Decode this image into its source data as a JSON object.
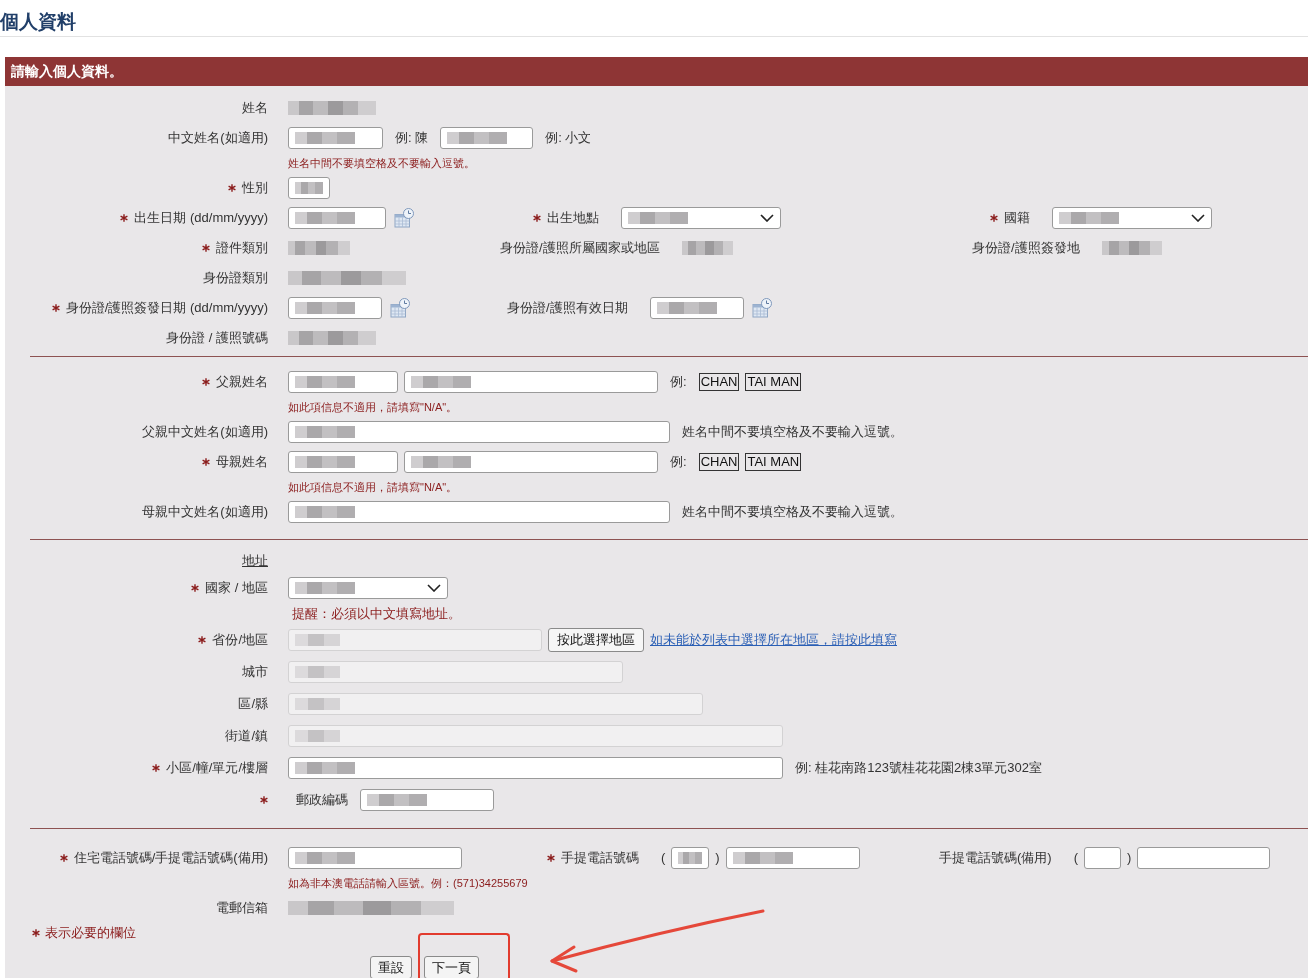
{
  "page_title": "個人資料",
  "panel": {
    "title": "請輸入個人資料。"
  },
  "sections": [
    {
      "rows": [
        {
          "kind": "fields",
          "cells": [
            {
              "label": "姓名",
              "required": false,
              "items": [
                {
                  "kind": "blurred"
                }
              ]
            }
          ]
        },
        {
          "kind": "fields",
          "cells": [
            {
              "label": "中文姓名(如適用)",
              "required": false,
              "items": [
                {
                  "kind": "input",
                  "filled": true
                },
                {
                  "kind": "hint",
                  "text": "例: 陳"
                },
                {
                  "kind": "input",
                  "filled": true
                },
                {
                  "kind": "hint",
                  "text": "例: 小文"
                }
              ]
            }
          ]
        },
        {
          "kind": "note",
          "text": "姓名中間不要填空格及不要輸入逗號。"
        },
        {
          "kind": "fields",
          "cells": [
            {
              "label": "性別",
              "required": true,
              "items": [
                {
                  "kind": "input",
                  "filled": true
                }
              ]
            }
          ]
        },
        {
          "kind": "fields",
          "cells": [
            {
              "label": "出生日期 (dd/mm/yyyy)",
              "required": true,
              "items": [
                {
                  "kind": "date",
                  "filled": true
                }
              ]
            },
            {
              "label": "出生地點",
              "required": true,
              "items": [
                {
                  "kind": "select",
                  "filled": true
                }
              ]
            },
            {
              "label": "國籍",
              "required": true,
              "items": [
                {
                  "kind": "select",
                  "filled": true
                }
              ]
            }
          ]
        },
        {
          "kind": "fields",
          "cells": [
            {
              "label": "證件類別",
              "required": true,
              "items": [
                {
                  "kind": "blurred"
                }
              ]
            },
            {
              "label": "身份證/護照所屬國家或地區",
              "required": false,
              "items": [
                {
                  "kind": "blurred"
                }
              ]
            },
            {
              "label": "身份證/護照簽發地",
              "required": false,
              "items": [
                {
                  "kind": "blurred"
                }
              ]
            }
          ]
        },
        {
          "kind": "fields",
          "cells": [
            {
              "label": "身份證類別",
              "required": false,
              "items": [
                {
                  "kind": "blurred"
                }
              ]
            }
          ]
        },
        {
          "kind": "fields",
          "cells": [
            {
              "label": "身份證/護照簽發日期 (dd/mm/yyyy)",
              "required": true,
              "items": [
                {
                  "kind": "date",
                  "filled": true
                }
              ]
            },
            {
              "label": "身份證/護照有效日期",
              "required": false,
              "items": [
                {
                  "kind": "date",
                  "filled": true
                }
              ]
            }
          ]
        },
        {
          "kind": "fields",
          "cells": [
            {
              "label": "身份證 / 護照號碼",
              "required": false,
              "items": [
                {
                  "kind": "blurred"
                }
              ]
            }
          ]
        }
      ]
    },
    {
      "rows": [
        {
          "kind": "fields",
          "cells": [
            {
              "label": "父親姓名",
              "required": true,
              "items": [
                {
                  "kind": "input",
                  "filled": true
                },
                {
                  "kind": "input",
                  "filled": true
                },
                {
                  "kind": "hint",
                  "text": "例:"
                },
                {
                  "kind": "example",
                  "text": "CHAN"
                },
                {
                  "kind": "example",
                  "text": "TAI MAN"
                }
              ]
            }
          ]
        },
        {
          "kind": "note",
          "text": "如此項信息不適用，請填寫\"N/A\"。"
        },
        {
          "kind": "fields",
          "cells": [
            {
              "label": "父親中文姓名(如適用)",
              "required": false,
              "items": [
                {
                  "kind": "input",
                  "filled": true
                },
                {
                  "kind": "hint",
                  "text": "姓名中間不要填空格及不要輸入逗號。"
                }
              ]
            }
          ]
        },
        {
          "kind": "fields",
          "cells": [
            {
              "label": "母親姓名",
              "required": true,
              "items": [
                {
                  "kind": "input",
                  "filled": true
                },
                {
                  "kind": "input",
                  "filled": true
                },
                {
                  "kind": "hint",
                  "text": "例:"
                },
                {
                  "kind": "example",
                  "text": "CHAN"
                },
                {
                  "kind": "example",
                  "text": "TAI MAN"
                }
              ]
            }
          ]
        },
        {
          "kind": "note",
          "text": "如此項信息不適用，請填寫\"N/A\"。"
        },
        {
          "kind": "fields",
          "cells": [
            {
              "label": "母親中文姓名(如適用)",
              "required": false,
              "items": [
                {
                  "kind": "input",
                  "filled": true
                },
                {
                  "kind": "hint",
                  "text": "姓名中間不要填空格及不要輸入逗號。"
                }
              ]
            }
          ]
        }
      ]
    },
    {
      "rows": [
        {
          "kind": "heading",
          "text": "地址"
        },
        {
          "kind": "fields",
          "cells": [
            {
              "label": "國家 / 地區",
              "required": true,
              "items": [
                {
                  "kind": "select",
                  "filled": true
                }
              ]
            }
          ]
        },
        {
          "kind": "reminder",
          "text": "提醒：必須以中文填寫地址。"
        },
        {
          "kind": "fields",
          "cells": [
            {
              "label": "省份/地區",
              "required": true,
              "items": [
                {
                  "kind": "readonly",
                  "filled": true
                },
                {
                  "kind": "button",
                  "text": "按此選擇地區"
                },
                {
                  "kind": "link",
                  "text": "如未能於列表中選擇所在地區，請按此填寫"
                }
              ]
            }
          ]
        },
        {
          "kind": "fields",
          "cells": [
            {
              "label": "城市",
              "required": false,
              "items": [
                {
                  "kind": "readonly",
                  "filled": true
                }
              ]
            }
          ]
        },
        {
          "kind": "fields",
          "cells": [
            {
              "label": "區/縣",
              "required": false,
              "items": [
                {
                  "kind": "readonly",
                  "filled": true
                }
              ]
            }
          ]
        },
        {
          "kind": "fields",
          "cells": [
            {
              "label": "街道/鎮",
              "required": false,
              "items": [
                {
                  "kind": "readonly",
                  "filled": true
                }
              ]
            }
          ]
        },
        {
          "kind": "fields",
          "cells": [
            {
              "label": "小區/幢/單元/樓層",
              "required": true,
              "items": [
                {
                  "kind": "input",
                  "filled": true
                },
                {
                  "kind": "hint",
                  "text": "例: 桂花南路123號桂花花園2棟3單元302室"
                }
              ]
            }
          ]
        },
        {
          "kind": "fields",
          "cells": [
            {
              "required": true,
              "items": [
                {
                  "kind": "text",
                  "text": "郵政編碼"
                },
                {
                  "kind": "input",
                  "filled": true
                }
              ]
            }
          ]
        }
      ]
    },
    {
      "rows": [
        {
          "kind": "fields",
          "cells": [
            {
              "label": "住宅電話號碼/手提電話號碼(備用)",
              "required": true,
              "items": [
                {
                  "kind": "input",
                  "filled": true
                }
              ]
            },
            {
              "label": "手提電話號碼",
              "required": true,
              "items": [
                {
                  "kind": "paren",
                  "text": "("
                },
                {
                  "kind": "input",
                  "filled": true
                },
                {
                  "kind": "paren",
                  "text": ")"
                },
                {
                  "kind": "input",
                  "filled": true
                }
              ]
            },
            {
              "label": "手提電話號碼(備用)",
              "required": false,
              "items": [
                {
                  "kind": "paren",
                  "text": "("
                },
                {
                  "kind": "input",
                  "filled": false
                },
                {
                  "kind": "paren",
                  "text": ")"
                },
                {
                  "kind": "input",
                  "filled": false
                }
              ]
            }
          ]
        },
        {
          "kind": "note",
          "text": "如為非本澳電話請輸入區號。例：(571)34255679"
        },
        {
          "kind": "fields",
          "cells": [
            {
              "label": "電郵信箱",
              "required": false,
              "items": [
                {
                  "kind": "blurred"
                }
              ]
            }
          ]
        }
      ]
    }
  ],
  "footer": {
    "legend": "表示必要的欄位",
    "buttons": [
      {
        "label": "重設",
        "highlighted": false
      },
      {
        "label": "下一頁",
        "highlighted": true
      }
    ]
  }
}
